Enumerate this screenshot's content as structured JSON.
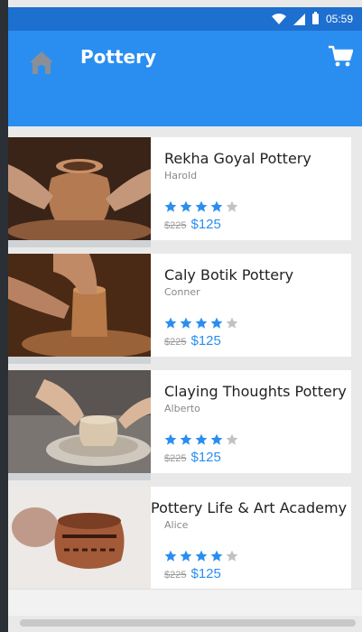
{
  "status_bar": {
    "time": "05:59"
  },
  "app_bar": {
    "title": "Pottery"
  },
  "products": [
    {
      "name": "Rekha Goyal Pottery",
      "owner": "Harold",
      "rating": 4,
      "rating_max": 5,
      "old_price": "$225",
      "price": "$125",
      "image": "hands-shaping-pot-on-wheel"
    },
    {
      "name": "Caly Botik Pottery",
      "owner": "Conner",
      "rating": 4,
      "rating_max": 5,
      "old_price": "$225",
      "price": "$125",
      "image": "clay-cylinder-on-wheel"
    },
    {
      "name": "Claying Thoughts Pottery",
      "owner": "Alberto",
      "rating": 4,
      "rating_max": 5,
      "old_price": "$225",
      "price": "$125",
      "image": "bowl-on-wheel"
    },
    {
      "name": "Pottery Life & Art Academy",
      "owner": "Alice",
      "rating": 4,
      "rating_max": 5,
      "old_price": "$225",
      "price": "$125",
      "image": "decorated-terracotta-pot"
    }
  ],
  "colors": {
    "status_bar": "#1d6fd0",
    "app_bar": "#2a8ef0",
    "star_filled": "#2a8ef0",
    "star_empty": "#c2c2c2",
    "price": "#2a8ef0"
  }
}
